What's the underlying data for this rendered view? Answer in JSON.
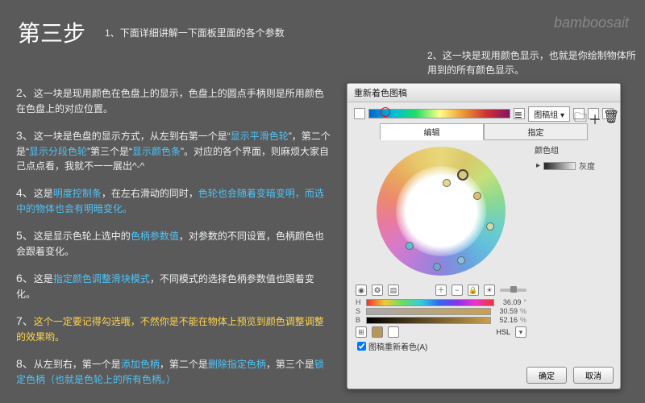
{
  "title": "第三步",
  "watermark": "bamboosait",
  "intro_n": "1、",
  "intro": "下面详细讲解一下面板里面的各个参数",
  "anno2top_n": "2、",
  "anno2top": "这一块是现用颜色显示，也就是你绘制物体所用到的所有颜色显示。",
  "annos": [
    {
      "n": "2、",
      "t": "这一块是现用颜色在色盘上的显示，色盘上的圆点手柄则是所用颜色在色盘上的对应位置。"
    },
    {
      "n": "3、",
      "p": [
        {
          "t": "这一块是色盘的显示方式，从左到右第一个是“"
        },
        {
          "t": "显示平滑色轮",
          "c": "hl"
        },
        {
          "t": "”，第二个是“"
        },
        {
          "t": "显示分段色轮",
          "c": "hl"
        },
        {
          "t": "”第三个是“"
        },
        {
          "t": "显示颜色条",
          "c": "hl"
        },
        {
          "t": "”。对应的各个界面，则麻烦大家自己点点看，我就不一一展出^-^"
        }
      ]
    },
    {
      "n": "4、",
      "p": [
        {
          "t": "这是"
        },
        {
          "t": "明度控制条",
          "c": "hl"
        },
        {
          "t": "，在左右滑动的同时，"
        },
        {
          "t": "色轮也会随着变暗变明，而选中的物体也会有明暗变化。",
          "c": "hl"
        }
      ]
    },
    {
      "n": "5、",
      "p": [
        {
          "t": "这是显示色轮上选中的"
        },
        {
          "t": "色柄参数值",
          "c": "hl"
        },
        {
          "t": "，对参数的不同设置，色柄颜色也会跟着变化。"
        }
      ]
    },
    {
      "n": "6、",
      "p": [
        {
          "t": "这是"
        },
        {
          "t": "指定颜色调整滑块模式",
          "c": "hl"
        },
        {
          "t": "，不同模式的选择色柄参数值也跟着变化。"
        }
      ]
    },
    {
      "n": "7、",
      "p": [
        {
          "t": "这个一定要记得勾选哦，不然你是不能在物体上预览到颜色调整调整的效果哟。",
          "c": "hly"
        }
      ]
    },
    {
      "n": "8、",
      "p": [
        {
          "t": "从左到右，第一个是"
        },
        {
          "t": "添加色柄",
          "c": "hl"
        },
        {
          "t": "，第二个是"
        },
        {
          "t": "删除指定色柄",
          "c": "hl"
        },
        {
          "t": "，第三个是"
        },
        {
          "t": "锁定色柄（也就是色轮上的所有色柄。）",
          "c": "hl"
        }
      ]
    }
  ],
  "panel": {
    "title": "重新着色图稿",
    "dropdown": "图稿组",
    "tabs": {
      "edit": "编辑",
      "assign": "指定"
    },
    "side": {
      "header": "颜色组",
      "item": "灰度"
    },
    "sliders": {
      "rows": [
        {
          "l": "H",
          "v": "36.09",
          "p": "°"
        },
        {
          "l": "S",
          "v": "30.59",
          "p": "%"
        },
        {
          "l": "B",
          "v": "52.16",
          "p": "%"
        }
      ],
      "mode": "HSL"
    },
    "recolor": "图稿重新着色(A)",
    "ok": "确定",
    "cancel": "取消"
  }
}
